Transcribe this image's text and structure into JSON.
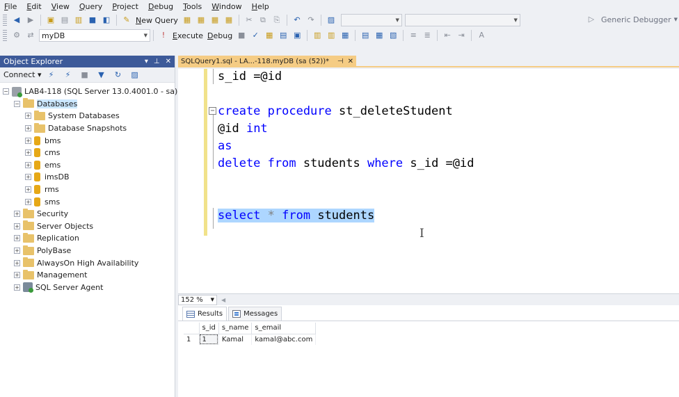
{
  "menu": [
    "File",
    "Edit",
    "View",
    "Query",
    "Project",
    "Debug",
    "Tools",
    "Window",
    "Help"
  ],
  "toolbar1": {
    "new_query": "New Query",
    "debugger": "Generic Debugger"
  },
  "toolbar2": {
    "database": "myDB",
    "execute": "Execute",
    "debug": "Debug"
  },
  "object_explorer": {
    "title": "Object Explorer",
    "connect": "Connect",
    "server": "LAB4-118 (SQL Server 13.0.4001.0 - sa)",
    "databases": "Databases",
    "system_databases": "System Databases",
    "database_snapshots": "Database Snapshots",
    "db_items": [
      "bms",
      "cms",
      "ems",
      "imsDB",
      "rms",
      "sms"
    ],
    "security": "Security",
    "server_objects": "Server Objects",
    "replication": "Replication",
    "polybase": "PolyBase",
    "alwayson": "AlwaysOn High Availability",
    "management": "Management",
    "agent": "SQL Server Agent"
  },
  "editor": {
    "tab_title": "SQLQuery1.sql - LA...-118.myDB (sa (52))*",
    "line1_prefix": "s_id ",
    "line1_rest": "=@id",
    "create_kw": "create procedure",
    "proc_name": " st_deleteStudent",
    "param": "@id ",
    "param_type": "int",
    "as_kw": "as",
    "delete_kw": "delete from",
    "delete_table": " students ",
    "where_kw": "where",
    "delete_rest": " s_id =@id",
    "select_kw": "select",
    "star": " * ",
    "from_kw": "from",
    "select_rest": " students"
  },
  "zoom": "152 %",
  "results": {
    "tab_results": "Results",
    "tab_messages": "Messages",
    "columns": [
      "s_id",
      "s_name",
      "s_email"
    ],
    "rows": [
      {
        "num": "1",
        "s_id": "1",
        "s_name": "Kamal",
        "s_email": "kamal@abc.com"
      }
    ]
  },
  "colors": {
    "oe_header": "#3d5a99",
    "tab_active": "#f5cc84",
    "keyword": "#0000ff",
    "selection": "#add6ff"
  }
}
